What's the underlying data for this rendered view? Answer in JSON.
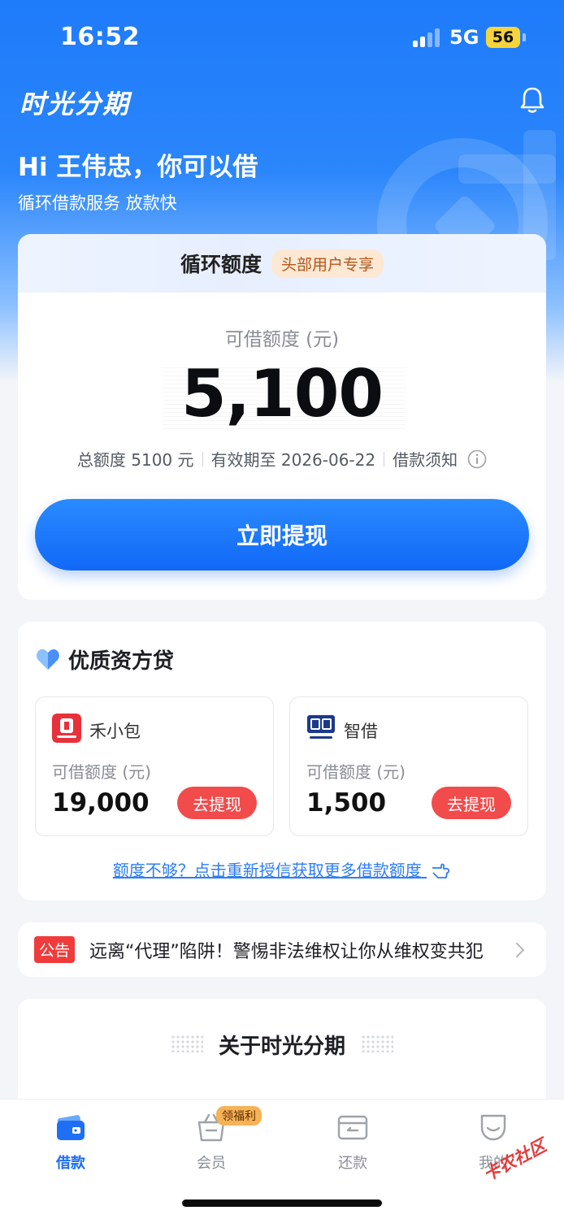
{
  "status_bar": {
    "time": "16:52",
    "network": "5G",
    "battery": "56"
  },
  "header": {
    "app_name": "时光分期"
  },
  "hero": {
    "greeting": "Hi 王伟忠，你可以借",
    "subtitle": "循环借款服务 放款快"
  },
  "credit": {
    "title": "循环额度",
    "badge": "头部用户专享",
    "amount_label": "可借额度 (元)",
    "amount": "5,100",
    "total": "总额度 5100 元",
    "validity": "有效期至 2026-06-22",
    "notice_link": "借款须知",
    "withdraw_button": "立即提现"
  },
  "lenders": {
    "title": "优质资方贷",
    "items": [
      {
        "name": "禾小包",
        "label": "可借额度 (元)",
        "amount": "19,000",
        "button": "去提现",
        "logo_color": "#e8313b"
      },
      {
        "name": "智借",
        "label": "可借额度 (元)",
        "amount": "1,500",
        "button": "去提现",
        "logo_color": "#1b3a8c"
      }
    ],
    "more_link": "额度不够？点击重新授信获取更多借款额度"
  },
  "notice": {
    "tag": "公告",
    "text": "远离“代理”陷阱！警惕非法维权让你从维权变共犯"
  },
  "about": {
    "title": "关于时光分期"
  },
  "tab_bar": {
    "items": [
      {
        "label": "借款",
        "icon": "wallet-icon",
        "active": true
      },
      {
        "label": "会员",
        "icon": "basket-icon",
        "badge": "领福利"
      },
      {
        "label": "还款",
        "icon": "card-icon"
      },
      {
        "label": "我的",
        "icon": "smile-icon"
      }
    ]
  },
  "watermark": {
    "text": "卡农社区"
  },
  "colors": {
    "primary": "#1e6ff6",
    "danger": "#f24b4b",
    "badge_orange": "#f7b257"
  }
}
